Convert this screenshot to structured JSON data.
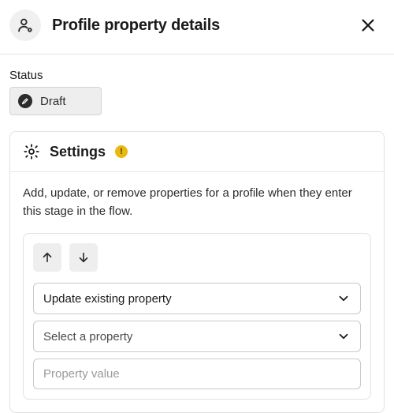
{
  "header": {
    "title": "Profile property details"
  },
  "status": {
    "label": "Status",
    "value": "Draft"
  },
  "settings": {
    "title": "Settings",
    "warning_glyph": "!",
    "description": "Add, update, or remove properties for a profile when they enter this stage in the flow.",
    "action_select": "Update existing property",
    "property_select": "Select a property",
    "value_placeholder": "Property value"
  }
}
